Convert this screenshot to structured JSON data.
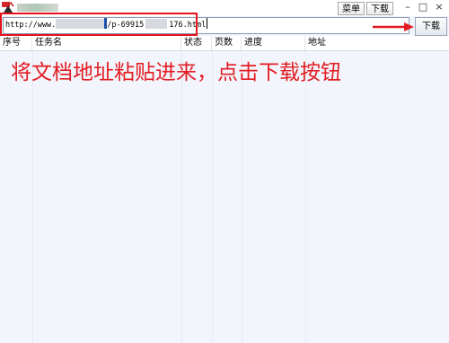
{
  "titlebar": {
    "menu_label": "菜单",
    "download_label": "下载",
    "minimize_glyph": "–",
    "maximize_glyph": "□",
    "close_glyph": "×",
    "logo_icon": "app-logo-icon"
  },
  "toolbar": {
    "url_prefix": "http://www.",
    "url_middle": "/p-69915",
    "url_suffix": "176.html",
    "go_label": "下载"
  },
  "list": {
    "columns": [
      "序号",
      "任务名",
      "状态",
      "页数",
      "进度",
      "地址"
    ]
  },
  "annotation": {
    "instruction": "将文档地址粘贴进来，点击下载按钮",
    "color": "#e31c23"
  }
}
